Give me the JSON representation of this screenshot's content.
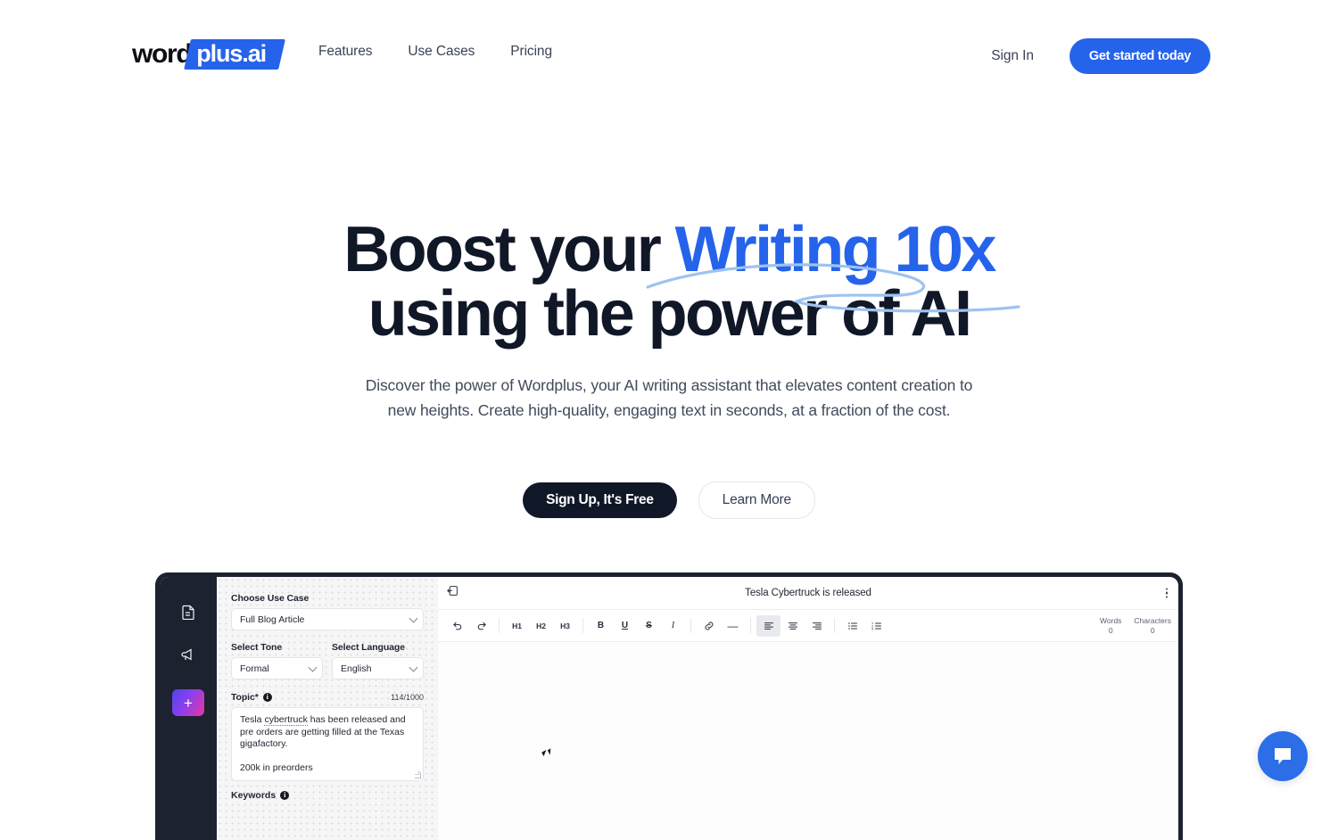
{
  "nav": {
    "logo": {
      "word": "word",
      "plus": "plus.ai"
    },
    "links": [
      {
        "label": "Features"
      },
      {
        "label": "Use Cases"
      },
      {
        "label": "Pricing"
      }
    ],
    "sign_in": "Sign In",
    "cta": "Get started today"
  },
  "hero": {
    "headline_part1": "Boost your ",
    "headline_highlight": "Writing 10x",
    "headline_line2": "using the power of AI",
    "subhead": "Discover the power of Wordplus, your AI writing assistant that elevates content creation to new heights. Create high-quality, engaging text in seconds, at a fraction of the cost.",
    "primary_button": "Sign Up, It's Free",
    "secondary_button": "Learn More"
  },
  "app": {
    "rail": {
      "icons": [
        "document-icon",
        "megaphone-icon"
      ],
      "add_label": "+"
    },
    "form": {
      "use_case_label": "Choose Use Case",
      "use_case_value": "Full Blog Article",
      "tone_label": "Select Tone",
      "tone_value": "Formal",
      "language_label": "Select Language",
      "language_value": "English",
      "topic_label": "Topic*",
      "topic_counter": "114/1000",
      "topic_text_a": "Tesla ",
      "topic_text_spell": "cybertruck",
      "topic_text_b": " has been released and pre orders are getting filled at the Texas gigafactory.",
      "topic_text_c": "200k in preorders",
      "next_label": "Keywords"
    },
    "editor": {
      "doc_title": "Tesla Cybertruck is released",
      "toolbar": [
        {
          "name": "undo",
          "glyph": "↺"
        },
        {
          "name": "redo",
          "glyph": "↻"
        },
        {
          "name": "heading-1",
          "glyph": "H1"
        },
        {
          "name": "heading-2",
          "glyph": "H2"
        },
        {
          "name": "heading-3",
          "glyph": "H3"
        },
        {
          "name": "bold",
          "glyph": "B"
        },
        {
          "name": "underline",
          "glyph": "U"
        },
        {
          "name": "strikethrough",
          "glyph": "S"
        },
        {
          "name": "italic",
          "glyph": "I"
        },
        {
          "name": "link",
          "glyph": "🔗"
        },
        {
          "name": "horizontal-rule",
          "glyph": "—"
        },
        {
          "name": "align-left",
          "glyph": "≡"
        },
        {
          "name": "align-center",
          "glyph": "≡"
        },
        {
          "name": "align-right",
          "glyph": "≡"
        },
        {
          "name": "bullet-list",
          "glyph": "☰"
        },
        {
          "name": "numbered-list",
          "glyph": "☰"
        }
      ],
      "words_label": "Words",
      "words_value": "0",
      "chars_label": "Characters",
      "chars_value": "0"
    }
  },
  "colors": {
    "brand_blue": "#2563eb",
    "dark": "#101828",
    "swoosh": "#9dc3f0",
    "chat_blue": "#2b6ee8"
  }
}
